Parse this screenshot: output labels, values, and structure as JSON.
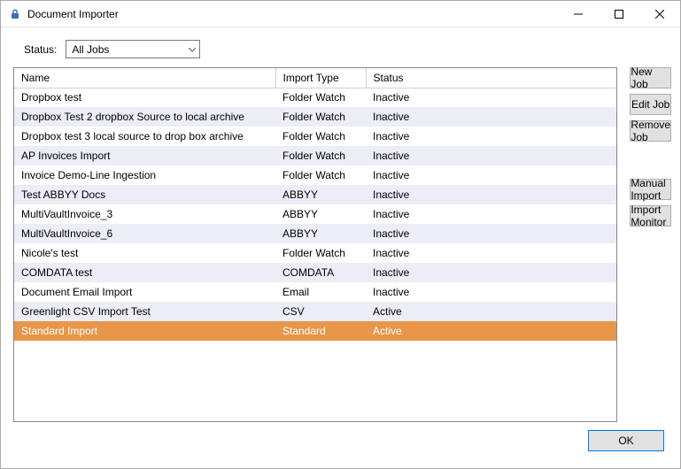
{
  "window": {
    "title": "Document Importer",
    "icon": "lock-icon"
  },
  "filter": {
    "label": "Status:",
    "selected": "All Jobs"
  },
  "columns": {
    "name": "Name",
    "import_type": "Import Type",
    "status": "Status"
  },
  "rows": [
    {
      "name": "Dropbox test",
      "type": "Folder Watch",
      "status": "Inactive",
      "selected": false
    },
    {
      "name": "Dropbox Test 2 dropbox Source to local archive",
      "type": "Folder Watch",
      "status": "Inactive",
      "selected": false
    },
    {
      "name": "Dropbox test 3 local source to drop box archive",
      "type": "Folder Watch",
      "status": "Inactive",
      "selected": false
    },
    {
      "name": "AP Invoices Import",
      "type": "Folder Watch",
      "status": "Inactive",
      "selected": false
    },
    {
      "name": "Invoice Demo-Line Ingestion",
      "type": "Folder Watch",
      "status": "Inactive",
      "selected": false
    },
    {
      "name": "Test ABBYY Docs",
      "type": "ABBYY",
      "status": "Inactive",
      "selected": false
    },
    {
      "name": "MultiVaultInvoice_3",
      "type": "ABBYY",
      "status": "Inactive",
      "selected": false
    },
    {
      "name": "MultiVaultInvoice_6",
      "type": "ABBYY",
      "status": "Inactive",
      "selected": false
    },
    {
      "name": "Nicole's test",
      "type": "Folder Watch",
      "status": "Inactive",
      "selected": false
    },
    {
      "name": "COMDATA test",
      "type": "COMDATA",
      "status": "Inactive",
      "selected": false
    },
    {
      "name": "Document Email Import",
      "type": "Email",
      "status": "Inactive",
      "selected": false
    },
    {
      "name": "Greenlight CSV Import Test",
      "type": "CSV",
      "status": "Active",
      "selected": false
    },
    {
      "name": "Standard Import",
      "type": "Standard",
      "status": "Active",
      "selected": true
    }
  ],
  "buttons": {
    "new_job": "New Job",
    "edit_job": "Edit Job",
    "remove_job": "Remove Job",
    "manual_import": "Manual Import",
    "import_monitor": "Import Monitor",
    "ok": "OK"
  }
}
